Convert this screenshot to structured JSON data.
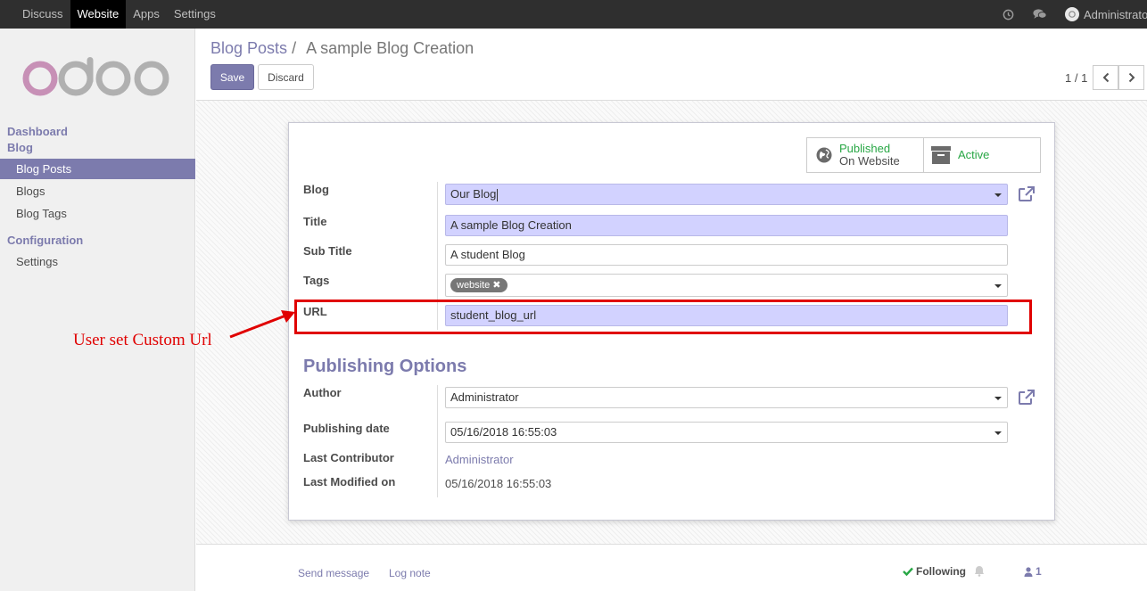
{
  "topbar": {
    "menu": [
      "Discuss",
      "Website",
      "Apps",
      "Settings"
    ],
    "active_menu": "Website",
    "user": "Administrator"
  },
  "sidebar": {
    "sections": [
      {
        "label": "Dashboard"
      },
      {
        "label": "Blog"
      },
      {
        "label": "Configuration"
      }
    ],
    "items": [
      {
        "label": "Blog Posts",
        "active": true
      },
      {
        "label": "Blogs"
      },
      {
        "label": "Blog Tags"
      },
      {
        "label": "Settings"
      }
    ]
  },
  "breadcrumb": {
    "parent": "Blog Posts",
    "separator": "/",
    "current": "A sample Blog Creation"
  },
  "buttons": {
    "save": "Save",
    "discard": "Discard"
  },
  "pager": {
    "text": "1 / 1"
  },
  "statusbox": {
    "published_line1": "Published",
    "published_line2": "On Website",
    "active": "Active"
  },
  "form": {
    "blog": {
      "label": "Blog",
      "value": "Our Blog"
    },
    "title": {
      "label": "Title",
      "value": "A sample Blog Creation"
    },
    "subtitle": {
      "label": "Sub Title",
      "value": "A student Blog"
    },
    "tags": {
      "label": "Tags",
      "values": [
        "website"
      ]
    },
    "url": {
      "label": "URL",
      "value": "student_blog_url"
    }
  },
  "publishing": {
    "title": "Publishing Options",
    "author": {
      "label": "Author",
      "value": "Administrator"
    },
    "date": {
      "label": "Publishing date",
      "value": "05/16/2018 16:55:03"
    },
    "last_contributor": {
      "label": "Last Contributor",
      "value": "Administrator"
    },
    "last_modified": {
      "label": "Last Modified on",
      "value": "05/16/2018 16:55:03"
    }
  },
  "annotation": {
    "text": "User set Custom Url",
    "color": "#e00000"
  },
  "chatter": {
    "send_message": "Send message",
    "log_note": "Log note",
    "following": "Following",
    "followers_count": "1"
  },
  "colors": {
    "accent": "#7c7bad",
    "required_field": "#d2d2ff",
    "published": "#28a745"
  }
}
